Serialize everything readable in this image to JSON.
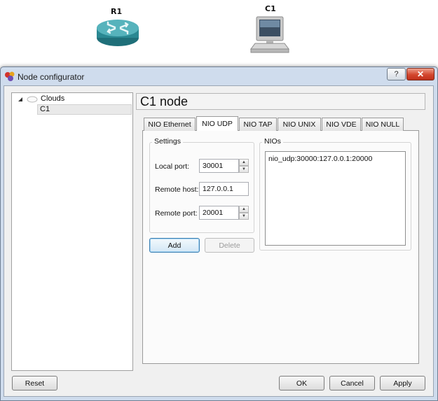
{
  "topology": {
    "nodes": [
      {
        "label": "R1",
        "icon": "router-icon"
      },
      {
        "label": "C1",
        "icon": "computer-icon"
      }
    ]
  },
  "dialog": {
    "title": "Node configurator",
    "help_label": "?",
    "close_label": "✕"
  },
  "tree": {
    "group_label": "Clouds",
    "items": [
      {
        "label": "C1",
        "selected": true
      }
    ]
  },
  "node_title": "C1 node",
  "tabs": [
    {
      "label": "NIO Ethernet",
      "active": false
    },
    {
      "label": "NIO UDP",
      "active": true
    },
    {
      "label": "NIO TAP",
      "active": false
    },
    {
      "label": "NIO UNIX",
      "active": false
    },
    {
      "label": "NIO VDE",
      "active": false
    },
    {
      "label": "NIO NULL",
      "active": false
    }
  ],
  "settings": {
    "group_label": "Settings",
    "local_port_label": "Local port:",
    "local_port_value": "30001",
    "remote_host_label": "Remote host:",
    "remote_host_value": "127.0.0.1",
    "remote_port_label": "Remote port:",
    "remote_port_value": "20001"
  },
  "nios": {
    "group_label": "NIOs",
    "items": [
      "nio_udp:30000:127.0.0.1:20000"
    ]
  },
  "buttons": {
    "add": "Add",
    "delete": "Delete",
    "reset": "Reset",
    "ok": "OK",
    "cancel": "Cancel",
    "apply": "Apply"
  },
  "colors": {
    "router": "#2f8c97",
    "window_frame": "#cfdced",
    "close_button": "#c9412a"
  }
}
